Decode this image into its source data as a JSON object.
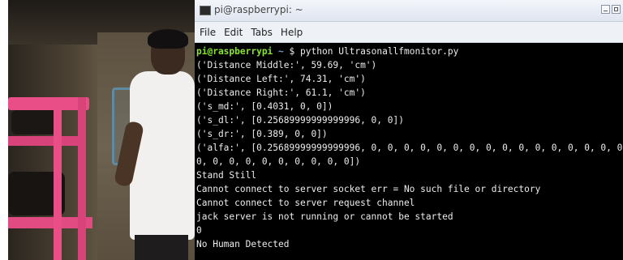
{
  "window": {
    "title": "pi@raspberrypi: ~",
    "icon": "terminal-icon"
  },
  "menu": {
    "items": [
      "File",
      "Edit",
      "Tabs",
      "Help"
    ]
  },
  "terminal": {
    "prompt_user": "pi@raspberrypi",
    "prompt_path": "~",
    "prompt_symbol": "$",
    "command": "python Ultrasonallfmonitor.py",
    "output": [
      "('Distance Middle:', 59.69, 'cm')",
      "('Distance Left:', 74.31, 'cm')",
      "('Distance Right:', 61.1, 'cm')",
      "('s_md:', [0.4031, 0, 0])",
      "('s_dl:', [0.25689999999999996, 0, 0])",
      "('s_dr:', [0.389, 0, 0])",
      "('alfa:', [0.25689999999999996, 0, 0, 0, 0, 0, 0, 0, 0, 0, 0, 0, 0, 0, 0, 0, 0,",
      "0, 0, 0, 0, 0, 0, 0, 0, 0, 0])",
      "Stand Still",
      "Cannot connect to server socket err = No such file or directory",
      "Cannot connect to server request channel",
      "jack server is not running or cannot be started",
      "0",
      "No Human Detected"
    ]
  },
  "colors": {
    "prompt_user": "#8ae234",
    "prompt_path": "#729fcf",
    "terminal_bg": "#000000",
    "terminal_fg": "#ececec"
  }
}
